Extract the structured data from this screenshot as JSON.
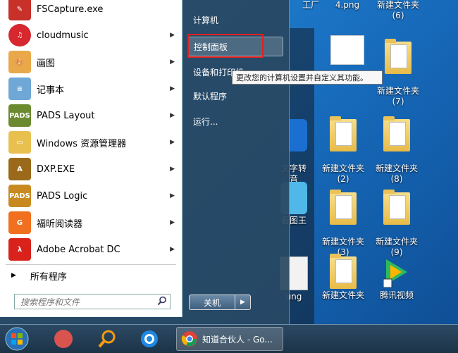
{
  "desktop": {
    "top_labels": [
      "工厂",
      "4.png",
      "新建文件夹\n(6)"
    ],
    "icons": [
      {
        "label": "新建文件夹\n(7)"
      },
      {
        "label": "新建文件夹\n(2)"
      },
      {
        "label": "新建文件夹\n(8)"
      },
      {
        "label": "新建文件夹\n(3)"
      },
      {
        "label": "新建文件夹\n(9)"
      },
      {
        "label": "新建文件夹"
      },
      {
        "label": "腾讯视频"
      },
      {
        "label": "文字转"
      },
      {
        "label": "音"
      },
      {
        "label": "看图王"
      },
      {
        "label": "ung"
      }
    ]
  },
  "start_menu": {
    "programs": [
      {
        "label": "FSCapture.exe",
        "icon": "fscapture-icon",
        "color": "#c8302a",
        "has_arrow": false
      },
      {
        "label": "cloudmusic",
        "icon": "cloudmusic-icon",
        "color": "#d7282f",
        "has_arrow": true
      },
      {
        "label": "画图",
        "icon": "paint-icon",
        "color": "#e9a84a",
        "has_arrow": true
      },
      {
        "label": "记事本",
        "icon": "notepad-icon",
        "color": "#6fa8d6",
        "has_arrow": true
      },
      {
        "label": "PADS Layout",
        "icon": "pads-layout-icon",
        "color": "#6b8a30",
        "has_arrow": true
      },
      {
        "label": "Windows 资源管理器",
        "icon": "explorer-icon",
        "color": "#e7c050",
        "has_arrow": true
      },
      {
        "label": "DXP.EXE",
        "icon": "dxp-icon",
        "color": "#9a6a1a",
        "has_arrow": true
      },
      {
        "label": "PADS Logic",
        "icon": "pads-logic-icon",
        "color": "#c88a20",
        "has_arrow": true
      },
      {
        "label": "福昕阅读器",
        "icon": "foxit-icon",
        "color": "#f07020",
        "has_arrow": true
      },
      {
        "label": "Adobe Acrobat DC",
        "icon": "acrobat-icon",
        "color": "#d8221b",
        "has_arrow": true
      }
    ],
    "all_programs": "所有程序",
    "search_placeholder": "搜索程序和文件",
    "right_items": [
      "计算机",
      "控制面板",
      "设备和打印机",
      "默认程序",
      "运行..."
    ],
    "tooltip": "更改您的计算机设置并自定义其功能。",
    "shutdown_label": "关机"
  },
  "taskbar": {
    "active_task_label": "知道合伙人 - Go..."
  }
}
